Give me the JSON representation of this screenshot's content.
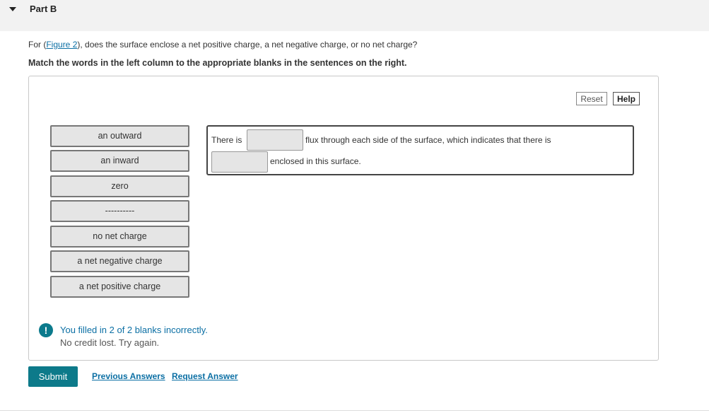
{
  "part": {
    "title": "Part B"
  },
  "question": {
    "prefix": "For (",
    "figure_link": "Figure 2",
    "suffix": "), does the surface enclose a net positive charge, a net negative charge, or no net charge?",
    "instruction": "Match the words in the left column to the appropriate blanks in the sentences on the right."
  },
  "toolbar": {
    "reset": "Reset",
    "help": "Help"
  },
  "word_bank": [
    "an outward",
    "an inward",
    "zero",
    "----------",
    "no net charge",
    "a net negative charge",
    "a net positive charge"
  ],
  "sentence": {
    "part1": "There is",
    "part2": "flux through each side of the surface, which indicates that there is",
    "part3": "enclosed in this surface."
  },
  "feedback": {
    "main": "You filled in 2 of 2 blanks incorrectly.",
    "sub": "No credit lost. Try again."
  },
  "actions": {
    "submit": "Submit",
    "previous_answers": "Previous Answers",
    "request_answer": "Request Answer"
  },
  "colors": {
    "accent": "#0d7a8a",
    "link": "#0b6fa4",
    "tile": "#e5e5e5"
  }
}
